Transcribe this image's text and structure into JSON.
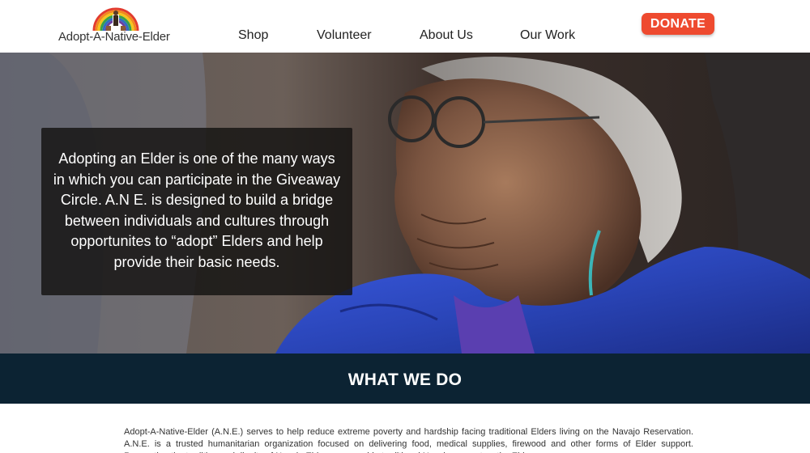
{
  "header": {
    "logo_text": "Adopt-A-Native-Elder",
    "nav": [
      {
        "label": "Shop"
      },
      {
        "label": "Volunteer"
      },
      {
        "label": "About Us"
      },
      {
        "label": "Our Work"
      }
    ],
    "donate_label": "DONATE"
  },
  "hero": {
    "text": "Adopting an Elder is one of the many ways in which you can participate in the Giveaway Circle. A.N E. is designed to build a bridge between individuals and cultures through opportunites to “adopt” Elders and help provide their basic needs."
  },
  "section": {
    "title": "WHAT WE DO",
    "body": "Adopt-A-Native-Elder (A.N.E.) serves to help reduce extreme poverty and hardship facing traditional Elders living on the Navajo Reservation. A.N.E. is a trusted humanitarian organization focused on delivering food, medical supplies, firewood and other forms of Elder support. Respecting the tradition and dignity of Navajo Elders, we provide traditional Navajo support so the Elders may"
  },
  "colors": {
    "donate": "#ee4a2f",
    "band": "#0c2333",
    "hero_jacket": "#2a45b8"
  },
  "icons": {
    "logo": "rainbow-elder-logo"
  }
}
